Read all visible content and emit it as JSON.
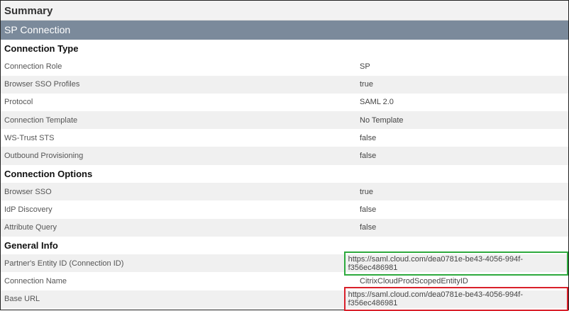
{
  "title": "Summary",
  "connection_bar": "SP Connection",
  "sections": [
    {
      "heading": "Connection Type",
      "rows": [
        {
          "label": "Connection Role",
          "value": "SP"
        },
        {
          "label": "Browser SSO Profiles",
          "value": "true"
        },
        {
          "label": "Protocol",
          "value": "SAML 2.0"
        },
        {
          "label": "Connection Template",
          "value": "No Template"
        },
        {
          "label": "WS-Trust STS",
          "value": "false"
        },
        {
          "label": "Outbound Provisioning",
          "value": "false"
        }
      ]
    },
    {
      "heading": "Connection Options",
      "rows": [
        {
          "label": "Browser SSO",
          "value": "true"
        },
        {
          "label": "IdP Discovery",
          "value": "false"
        },
        {
          "label": "Attribute Query",
          "value": "false"
        }
      ]
    },
    {
      "heading": "General Info",
      "rows": [
        {
          "label": "Partner's Entity ID (Connection ID)",
          "value": "https://saml.cloud.com/dea0781e-be43-4056-994f-f356ec486981"
        },
        {
          "label": "Connection Name",
          "value": "CitrixCloudProdScopedEntityID"
        },
        {
          "label": "Base URL",
          "value": "https://saml.cloud.com/dea0781e-be43-4056-994f-f356ec486981"
        }
      ]
    }
  ],
  "highlight_colors": {
    "entity_id": "#2eaa3e",
    "base_url": "#d9202a"
  }
}
